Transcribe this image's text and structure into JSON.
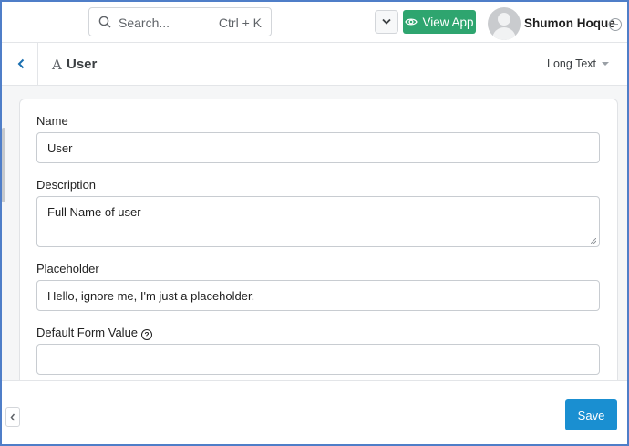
{
  "topbar": {
    "search_placeholder": "Search...",
    "search_shortcut": "Ctrl + K",
    "view_app_label": "View App",
    "user_name": "Shumon Hoque"
  },
  "header": {
    "field_type_glyph": "A",
    "field_title": "User",
    "field_type_select": "Long Text"
  },
  "form": {
    "name_label": "Name",
    "name_value": "User",
    "description_label": "Description",
    "description_value": "Full Name of user",
    "placeholder_label": "Placeholder",
    "placeholder_value": "Hello, ignore me, I'm just a placeholder.",
    "default_label": "Default Form Value",
    "default_value": ""
  },
  "footer": {
    "save_label": "Save"
  },
  "colors": {
    "view_app_bg": "#2ea56f",
    "save_bg": "#1a8fd1",
    "frame": "#4f7ec8",
    "back_chevron": "#1a6fb0"
  }
}
